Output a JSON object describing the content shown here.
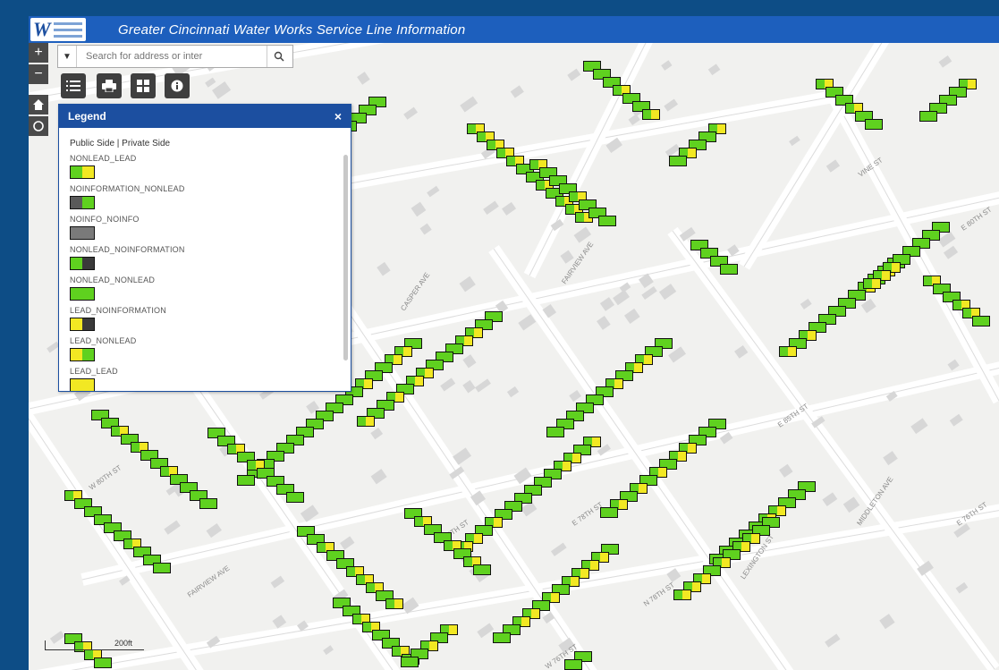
{
  "app": {
    "title": "Greater Cincinnati Water Works Service Line Information"
  },
  "search": {
    "placeholder": "Search for address or inter"
  },
  "toolbar": {
    "buttons": [
      {
        "icon": "legend-list-icon"
      },
      {
        "icon": "print-icon"
      },
      {
        "icon": "basemap-grid-icon"
      },
      {
        "icon": "info-icon"
      }
    ]
  },
  "map_controls": {
    "zoom_in": "+",
    "zoom_out": "−"
  },
  "legend": {
    "title": "Legend",
    "close": "×",
    "subtitle": "Public Side | Private Side",
    "items": [
      {
        "label": "NONLEAD_LEAD",
        "left": "#5fd11f",
        "right": "#f2e823"
      },
      {
        "label": "NOINFORMATION_NONLEAD",
        "left": "#5a5a5a",
        "right": "#5fd11f"
      },
      {
        "label": "NOINFO_NOINFO",
        "left": "#7a7a7a",
        "right": "#7a7a7a"
      },
      {
        "label": "NONLEAD_NOINFORMATION",
        "left": "#5fd11f",
        "right": "#3a3a3a"
      },
      {
        "label": "NONLEAD_NONLEAD",
        "left": "#5fd11f",
        "right": "#5fd11f"
      },
      {
        "label": "LEAD_NOINFORMATION",
        "left": "#f2e823",
        "right": "#3a3a3a"
      },
      {
        "label": "LEAD_NONLEAD",
        "left": "#f2e823",
        "right": "#5fd11f"
      },
      {
        "label": "LEAD_LEAD",
        "left": "#f2e823",
        "right": "#f2e823"
      }
    ]
  },
  "map": {
    "street_labels": [
      "W 80TH ST",
      "FAIRVIEW AVE",
      "CASPER AVE",
      "N 80TH ST",
      "E 80TH ST",
      "FAIRVIEW AVE",
      "VINE ST",
      "E 85TH ST",
      "LEXINGTON ST",
      "E 78TH ST",
      "E 76TH ST",
      "W 76TH ST",
      "N 78TH ST",
      "MIDDLETON AVE"
    ],
    "scale_label": "200ft",
    "colors": {
      "nonlead": "#5fd11f",
      "lead": "#f2e823",
      "noinfo": "#3a3a3a",
      "title_bar": "#1d5fbd"
    }
  }
}
